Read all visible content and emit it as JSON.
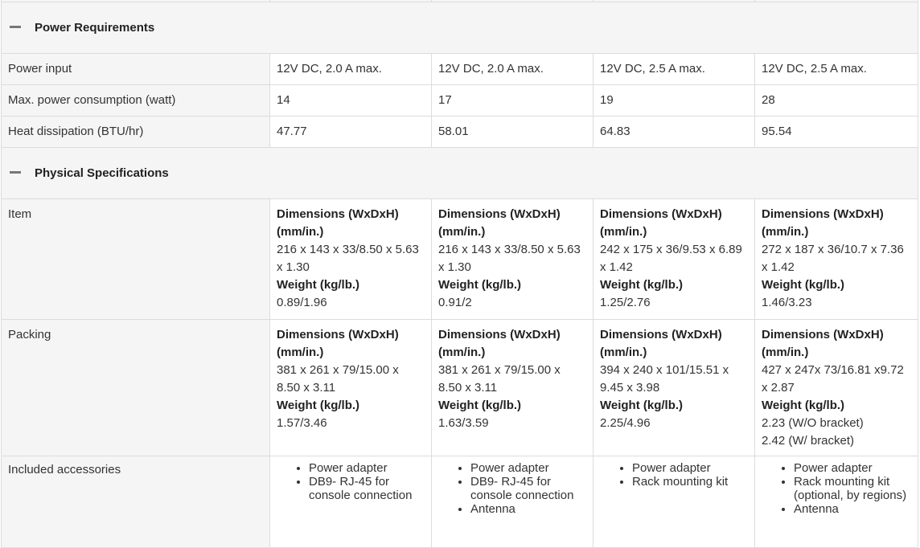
{
  "sections": {
    "power": {
      "title": "Power Requirements"
    },
    "physical": {
      "title": "Physical Specifications"
    }
  },
  "power_rows": [
    {
      "label": "Power input",
      "values": [
        "12V DC, 2.0 A max.",
        "12V DC, 2.0 A max.",
        "12V DC, 2.5 A max.",
        "12V DC, 2.5 A max."
      ]
    },
    {
      "label": "Max. power consumption (watt)",
      "values": [
        "14",
        "17",
        "19",
        "28"
      ]
    },
    {
      "label": "Heat dissipation (BTU/hr)",
      "values": [
        "47.77",
        "58.01",
        "64.83",
        "95.54"
      ]
    }
  ],
  "item": {
    "label": "Item",
    "dims_heading": "Dimensions (WxDxH)",
    "dims_unit": "(mm/in.)",
    "weight_heading": "Weight (kg/lb.)",
    "cols": [
      {
        "dims": "216 x 143 x 33/8.50 x 5.63 x 1.30",
        "weight": "0.89/1.96"
      },
      {
        "dims": "216 x 143 x 33/8.50 x 5.63 x 1.30",
        "weight": "0.91/2"
      },
      {
        "dims": "242 x 175 x 36/9.53 x 6.89 x 1.42",
        "weight": "1.25/2.76"
      },
      {
        "dims": "272 x 187 x 36/10.7 x 7.36 x 1.42",
        "weight": "1.46/3.23"
      }
    ]
  },
  "packing": {
    "label": "Packing",
    "dims_heading": "Dimensions (WxDxH)",
    "dims_unit": "(mm/in.)",
    "weight_heading": "Weight (kg/lb.)",
    "cols": [
      {
        "dims": "381 x 261 x 79/15.00 x 8.50 x 3.11",
        "weight": "1.57/3.46",
        "weight2": ""
      },
      {
        "dims": "381 x 261 x 79/15.00 x 8.50 x 3.11",
        "weight": "1.63/3.59",
        "weight2": ""
      },
      {
        "dims": "394 x 240 x 101/15.51 x 9.45 x 3.98",
        "weight": "2.25/4.96",
        "weight2": ""
      },
      {
        "dims": "427 x 247x 73/16.81 x9.72 x 2.87",
        "weight": "2.23 (W/O bracket)",
        "weight2": "2.42 (W/ bracket)"
      }
    ]
  },
  "accessories": {
    "label": "Included accessories",
    "cols": [
      [
        "Power adapter",
        "DB9- RJ-45 for console connection"
      ],
      [
        "Power adapter",
        "DB9- RJ-45 for console connection",
        "Antenna"
      ],
      [
        "Power adapter",
        "Rack mounting kit"
      ],
      [
        "Power adapter",
        "Rack mounting kit (optional, by regions)",
        "Antenna"
      ]
    ]
  }
}
